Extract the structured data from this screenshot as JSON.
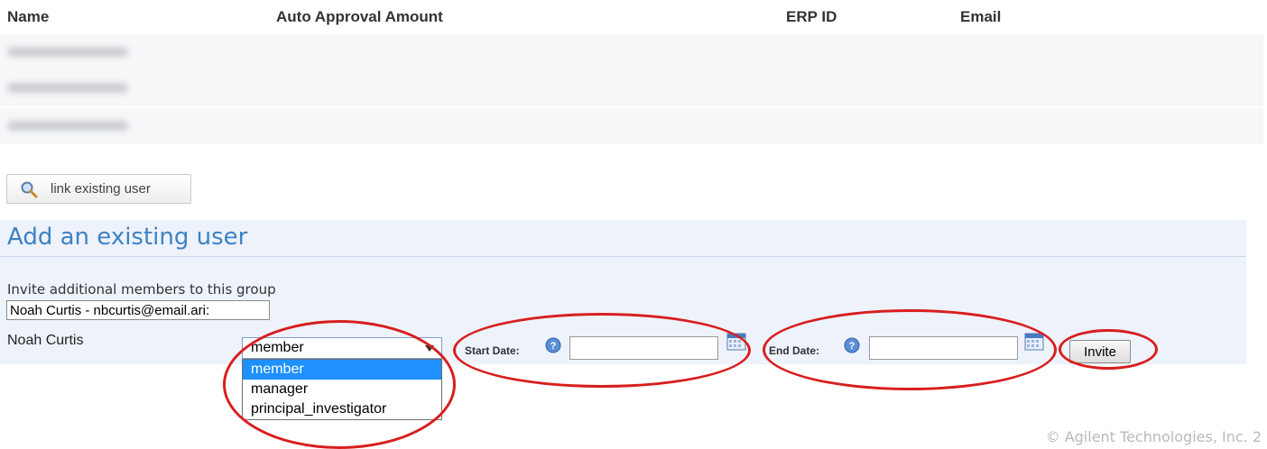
{
  "table": {
    "columns": [
      "Name",
      "Auto Approval Amount",
      "ERP ID",
      "Email"
    ]
  },
  "link_button": {
    "label": "link existing user",
    "icon": "search-icon"
  },
  "panel": {
    "title": "Add an existing user",
    "invite_label": "Invite additional members to this group",
    "user_input_value": "Noah Curtis - nbcurtis@email.ari:",
    "user_name": "Noah Curtis"
  },
  "role_select": {
    "selected": "member",
    "options": [
      "member",
      "manager",
      "principal_investigator"
    ]
  },
  "start_date": {
    "label": "Start Date:",
    "value": ""
  },
  "end_date": {
    "label": "End Date:",
    "value": ""
  },
  "invite_button": {
    "label": "Invite"
  },
  "footer": {
    "copyright": "© Agilent Technologies, Inc. 2"
  },
  "colors": {
    "title": "#3d82c4",
    "annotation": "#d81e1e",
    "selected_option": "#1e90ff"
  }
}
